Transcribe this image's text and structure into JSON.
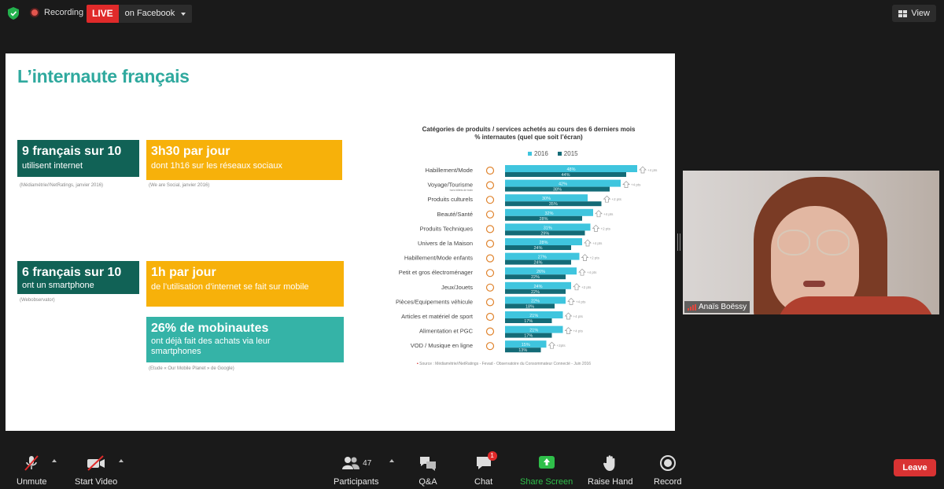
{
  "topbar": {
    "recording_label": "Recording",
    "live_label": "LIVE",
    "live_destination": "on Facebook",
    "view_label": "View"
  },
  "slide": {
    "title": "L’internaute français",
    "cards": [
      {
        "heading": "9 français sur 10",
        "text": "utilisent internet",
        "source": "(Médiamétrie//NetRatings, janvier 2016)"
      },
      {
        "heading": "3h30 par jour",
        "text": "dont 1h16 sur les réseaux sociaux",
        "source": "(We are Social, janvier 2016)"
      },
      {
        "heading": "6 français sur 10",
        "text": "ont un smartphone",
        "source": "(Webobservator)"
      },
      {
        "heading": "1h par jour",
        "text": "de l’utilisation d’internet se fait sur mobile",
        "source": ""
      },
      {
        "heading": "26% de mobinautes",
        "text": "ont déjà fait des achats via leur smartphones",
        "source": "(Etude « Our Mobile Planet » de Google)"
      }
    ]
  },
  "chart_data": {
    "type": "bar",
    "title": "Catégories de produits / services achetés au cours des 6 derniers mois",
    "subtitle": "% internautes (quel que soit l’écran)",
    "categories": [
      "Habillement/Mode",
      "Voyage/Tourisme",
      "Produits culturels",
      "Beauté/Santé",
      "Produits Techniques",
      "Univers de la Maison",
      "Habillement/Mode enfants",
      "Petit et gros électroménager",
      "Jeux/Jouets",
      "Pièces/Equipements véhicule",
      "Articles et matériel de sport",
      "Alimentation et PGC",
      "VOD / Musique en ligne"
    ],
    "category_note": "hors billets de train",
    "series": [
      {
        "name": "2016",
        "color": "#3fc5de",
        "values": [
          48,
          42,
          30,
          32,
          31,
          28,
          27,
          26,
          24,
          22,
          21,
          21,
          15
        ]
      },
      {
        "name": "2015",
        "color": "#146b77",
        "values": [
          44,
          38,
          35,
          28,
          29,
          24,
          24,
          22,
          22,
          18,
          17,
          17,
          13
        ]
      }
    ],
    "changes": [
      "+4 pts",
      "+4 pts",
      "+2 pts",
      "+4 pts",
      "+2 pts",
      "+4 pts",
      "+2 pts",
      "+4 pts",
      "+2 pts",
      "+4 pts",
      "+4 pts",
      "+4 pts",
      "+2pts"
    ],
    "icons": [
      "shirt-icon",
      "plane-icon",
      "music-note-icon",
      "eye-icon",
      "monitor-icon",
      "house-icon",
      "child-icon",
      "fridge-icon",
      "bike-icon",
      "car-icon",
      "ball-icon",
      "cart-icon",
      "headphones-icon"
    ],
    "source": "Source : Médiamétrie//NetRatings - Fevad - Observatoire du Consommateur Connecté - Juin 2016"
  },
  "video": {
    "participant_name": "Anaïs Boëssy"
  },
  "toolbar": {
    "unmute": "Unmute",
    "start_video": "Start Video",
    "participants": "Participants",
    "participant_count": "47",
    "qa": "Q&A",
    "chat": "Chat",
    "chat_badge": "1",
    "share_screen": "Share Screen",
    "raise_hand": "Raise Hand",
    "record": "Record",
    "leave": "Leave",
    "share_color": "#2fbf4a"
  }
}
